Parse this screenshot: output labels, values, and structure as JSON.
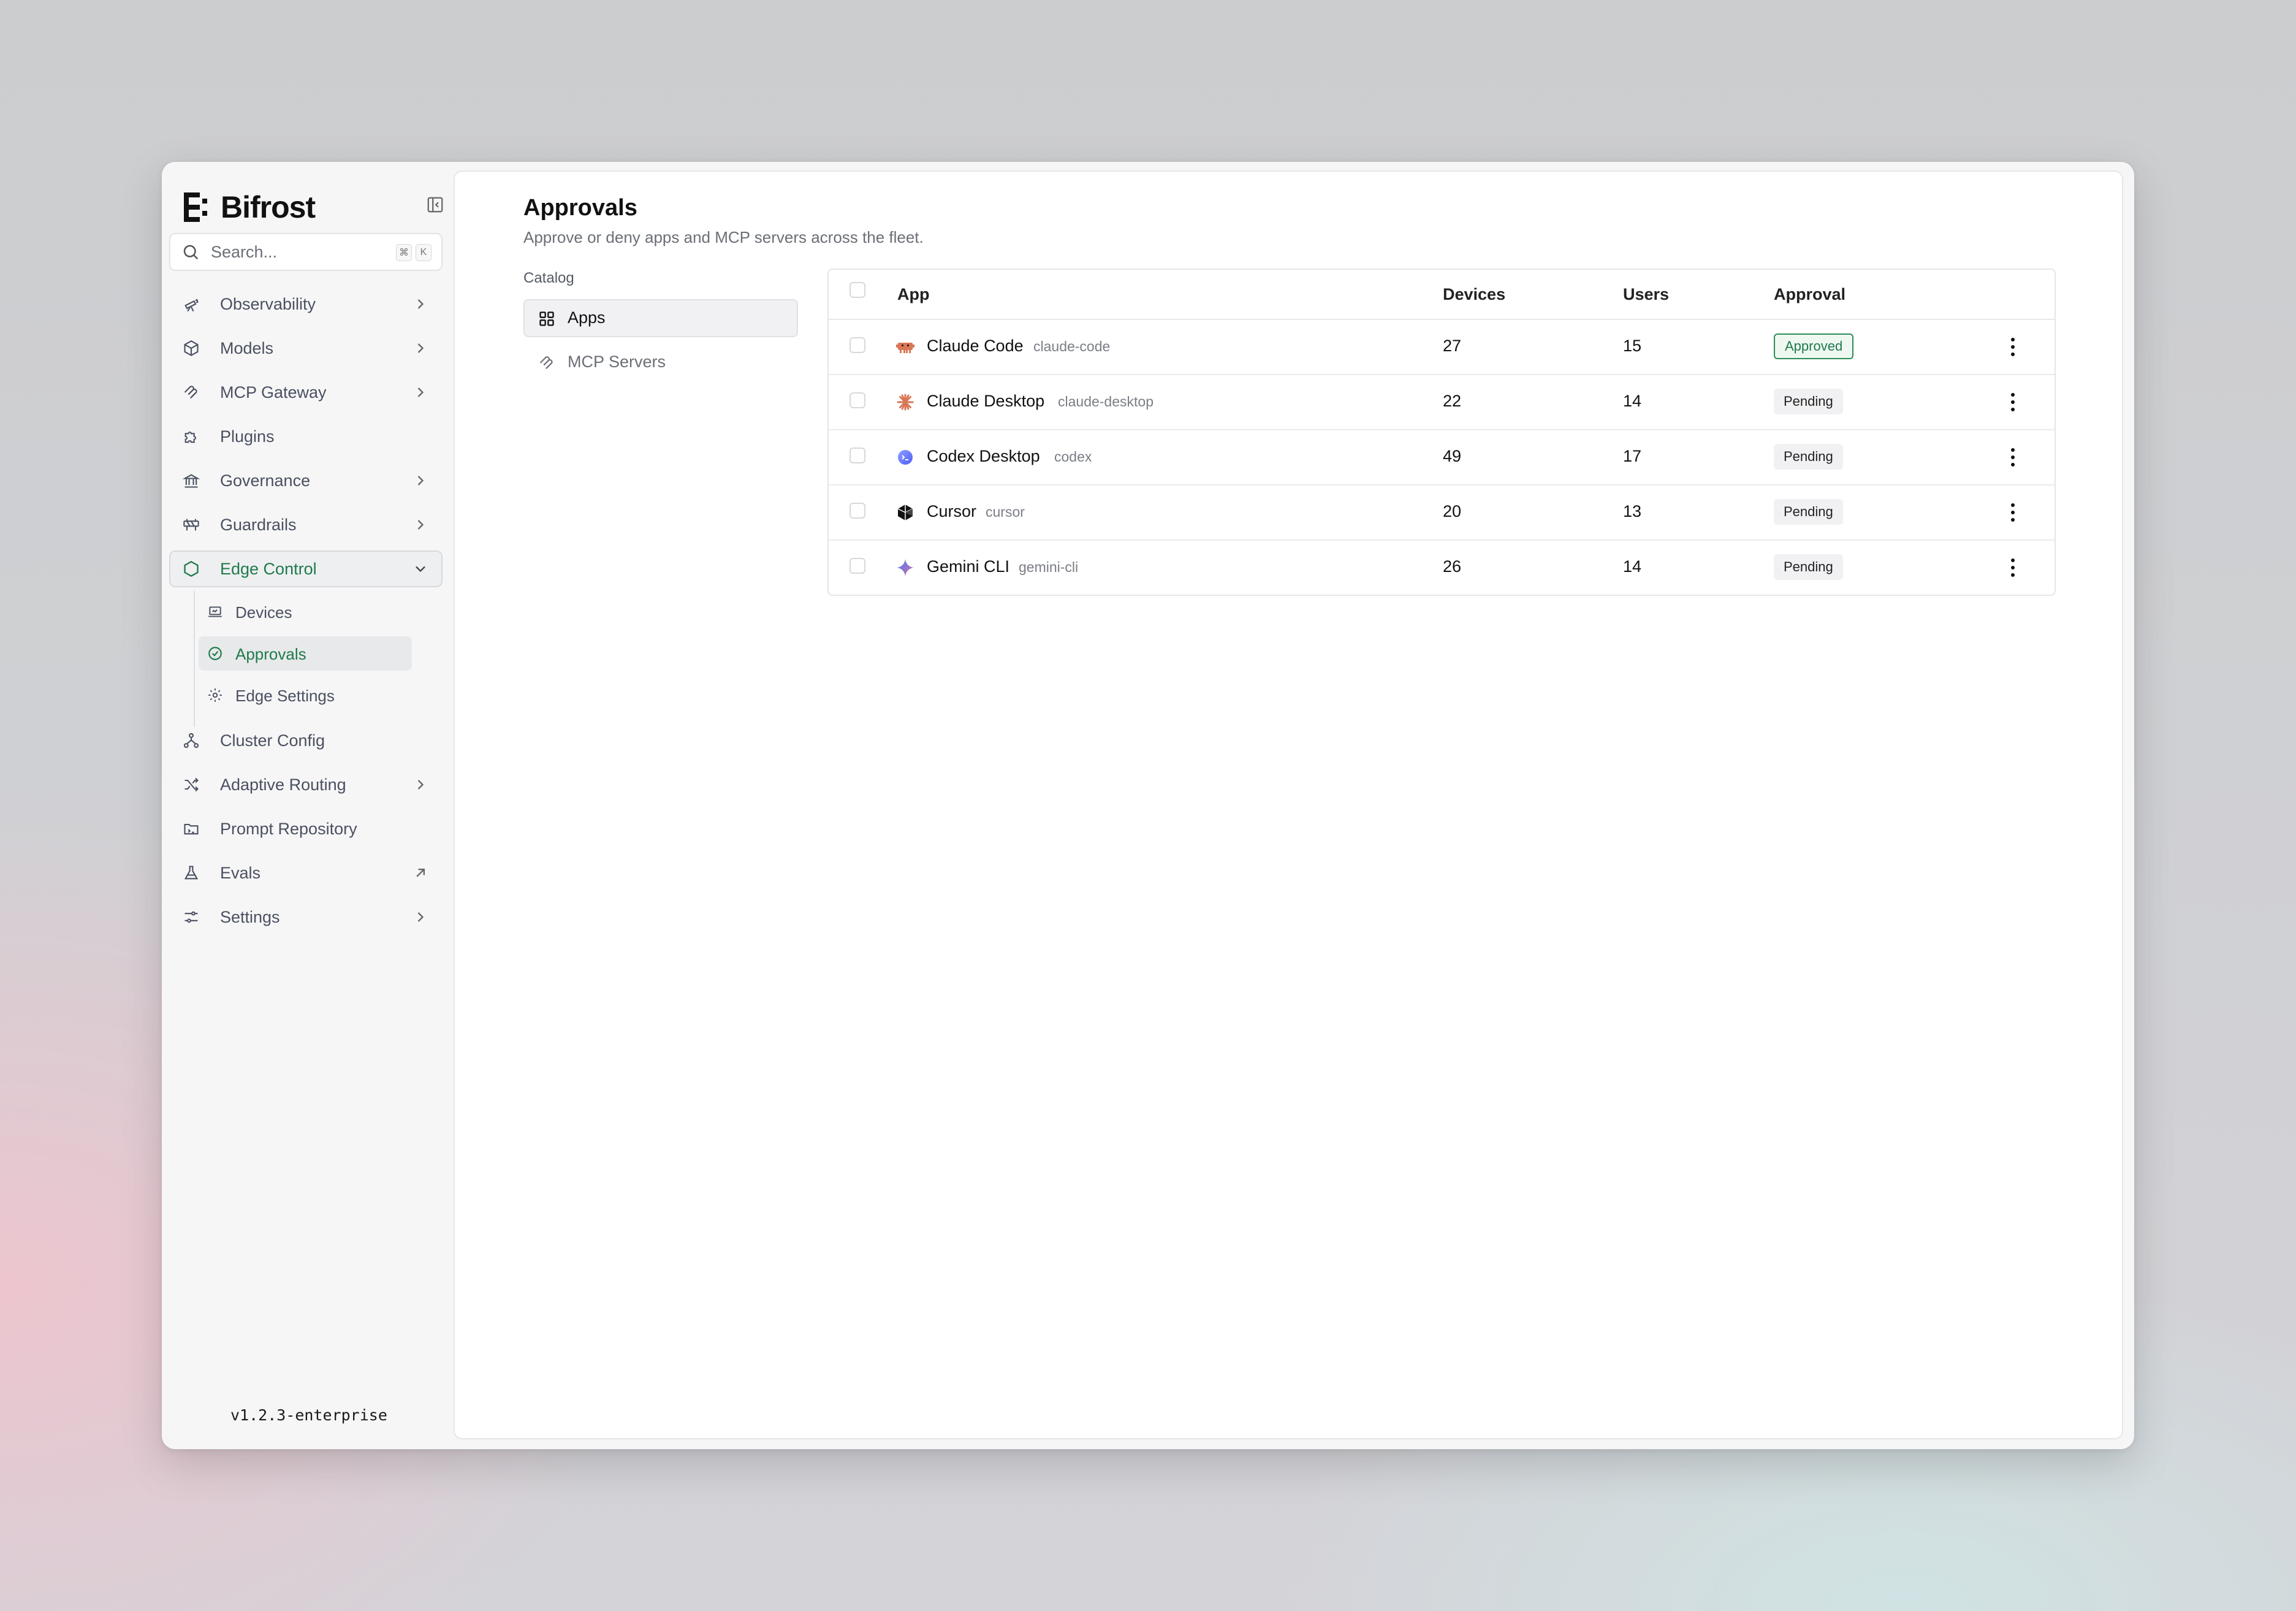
{
  "brand": {
    "name": "Bifrost"
  },
  "search": {
    "placeholder": "Search...",
    "kbd1": "⌘",
    "kbd2": "K"
  },
  "sidebar": {
    "items": [
      {
        "label": "Observability",
        "icon": "telescope-icon",
        "chevron": "right"
      },
      {
        "label": "Models",
        "icon": "box-icon",
        "chevron": "right"
      },
      {
        "label": "MCP Gateway",
        "icon": "mcp-icon",
        "chevron": "right"
      },
      {
        "label": "Plugins",
        "icon": "puzzle-icon",
        "chevron": "none"
      },
      {
        "label": "Governance",
        "icon": "landmark-icon",
        "chevron": "right"
      },
      {
        "label": "Guardrails",
        "icon": "construction-icon",
        "chevron": "right"
      },
      {
        "label": "Edge Control",
        "icon": "hexagon-icon",
        "chevron": "down",
        "active": true
      },
      {
        "label": "Cluster Config",
        "icon": "network-icon",
        "chevron": "none"
      },
      {
        "label": "Adaptive Routing",
        "icon": "shuffle-icon",
        "chevron": "right"
      },
      {
        "label": "Prompt Repository",
        "icon": "folder-icon",
        "chevron": "none"
      },
      {
        "label": "Evals",
        "icon": "flask-icon",
        "chevron": "external"
      },
      {
        "label": "Settings",
        "icon": "sliders-icon",
        "chevron": "right"
      }
    ],
    "sub_items": [
      {
        "label": "Devices",
        "icon": "laptop-icon"
      },
      {
        "label": "Approvals",
        "icon": "check-circle-icon",
        "active": true
      },
      {
        "label": "Edge Settings",
        "icon": "gear-icon"
      }
    ],
    "footer_icons": [
      "discord-icon",
      "github-icon",
      "bug-icon",
      "books-icon",
      "sun-icon",
      "user-icon"
    ],
    "version": "v1.2.3-enterprise"
  },
  "page": {
    "title": "Approvals",
    "subtitle": "Approve or deny apps and MCP servers across the fleet.",
    "catalog_label": "Catalog",
    "catalog_items": [
      {
        "label": "Apps",
        "icon": "grid-icon",
        "active": true
      },
      {
        "label": "MCP Servers",
        "icon": "mcp-icon"
      }
    ]
  },
  "table": {
    "headers": {
      "app": "App",
      "devices": "Devices",
      "users": "Users",
      "approval": "Approval"
    },
    "rows": [
      {
        "name": "Claude Code",
        "slug": "claude-code",
        "devices": "27",
        "users": "15",
        "approval": "Approved",
        "status": "approved",
        "icon": "claude-code-icon",
        "color": "#d97757"
      },
      {
        "name": "Claude Desktop",
        "slug": "claude-desktop",
        "devices": "22",
        "users": "14",
        "approval": "Pending",
        "status": "pending",
        "icon": "claude-desktop-icon",
        "color": "#d97757"
      },
      {
        "name": "Codex Desktop",
        "slug": "codex",
        "devices": "49",
        "users": "17",
        "approval": "Pending",
        "status": "pending",
        "icon": "codex-icon",
        "color": "#6b7cff"
      },
      {
        "name": "Cursor",
        "slug": "cursor",
        "devices": "20",
        "users": "13",
        "approval": "Pending",
        "status": "pending",
        "icon": "cursor-icon",
        "color": "#111111"
      },
      {
        "name": "Gemini CLI",
        "slug": "gemini-cli",
        "devices": "26",
        "users": "14",
        "approval": "Pending",
        "status": "pending",
        "icon": "gemini-icon",
        "color": "#4285f4"
      }
    ]
  },
  "colors": {
    "accent": "#1f7a4a",
    "text_muted": "#6b6f76"
  }
}
